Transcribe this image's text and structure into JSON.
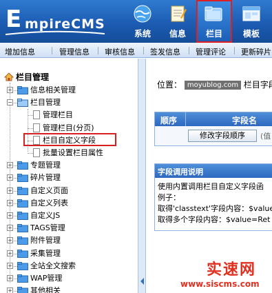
{
  "header": {
    "logo_initial": "E",
    "logo_rest": "mpireCMS",
    "nav": [
      {
        "label": "系统",
        "icon": "globe-icon"
      },
      {
        "label": "信息",
        "icon": "notepad-icon"
      },
      {
        "label": "栏目",
        "icon": "folder-icon",
        "active": true
      },
      {
        "label": "模板",
        "icon": "window-icon"
      }
    ]
  },
  "menubar": {
    "items": [
      "增加信息",
      "管理信息",
      "审核信息",
      "签发信息",
      "管理评论",
      "更新碎片"
    ]
  },
  "sidebar": {
    "root_label": "栏目管理",
    "items": [
      {
        "label": "信息相关管理",
        "expander": "+"
      },
      {
        "label": "栏目管理",
        "expander": "-"
      },
      {
        "label": "管理栏目",
        "child": true
      },
      {
        "label": "管理栏目(分页)",
        "child": true
      },
      {
        "label": "栏目自定义字段",
        "child": true,
        "highlighted": true
      },
      {
        "label": "批量设置栏目属性",
        "child": true
      },
      {
        "label": "专题管理",
        "expander": "+"
      },
      {
        "label": "碎片管理",
        "expander": "+"
      },
      {
        "label": "自定义页面",
        "expander": "+"
      },
      {
        "label": "自定义列表",
        "expander": "+"
      },
      {
        "label": "自定义JS",
        "expander": "+"
      },
      {
        "label": "TAGS管理",
        "expander": "+"
      },
      {
        "label": "附件管理",
        "expander": "+"
      },
      {
        "label": "采集管理",
        "expander": "+"
      },
      {
        "label": "全站全文搜索",
        "expander": "+"
      },
      {
        "label": "WAP管理",
        "expander": "+"
      },
      {
        "label": "其他相关",
        "expander": "+"
      }
    ]
  },
  "content": {
    "location_prefix": "位置：",
    "location_watermark": "moyublog.com",
    "location_suffix": "栏目字段",
    "table": {
      "col1": "顺序",
      "col2": "字段名",
      "sort_button": "修改字段顺序",
      "tail": "(值"
    },
    "usage": {
      "title": "字段调用说明",
      "lines": [
        "使用内置调用栏目自定义字段函",
        "例子：",
        "取得'classtext'字段内容：$value",
        "取得多个字段内容：$value=Ret"
      ]
    }
  },
  "brand": {
    "name": "实速网",
    "url": "www.siscms.com"
  },
  "colors": {
    "header_blue": "#1c5cb2",
    "highlight_red": "#d42020",
    "brand_red": "#e03020"
  }
}
